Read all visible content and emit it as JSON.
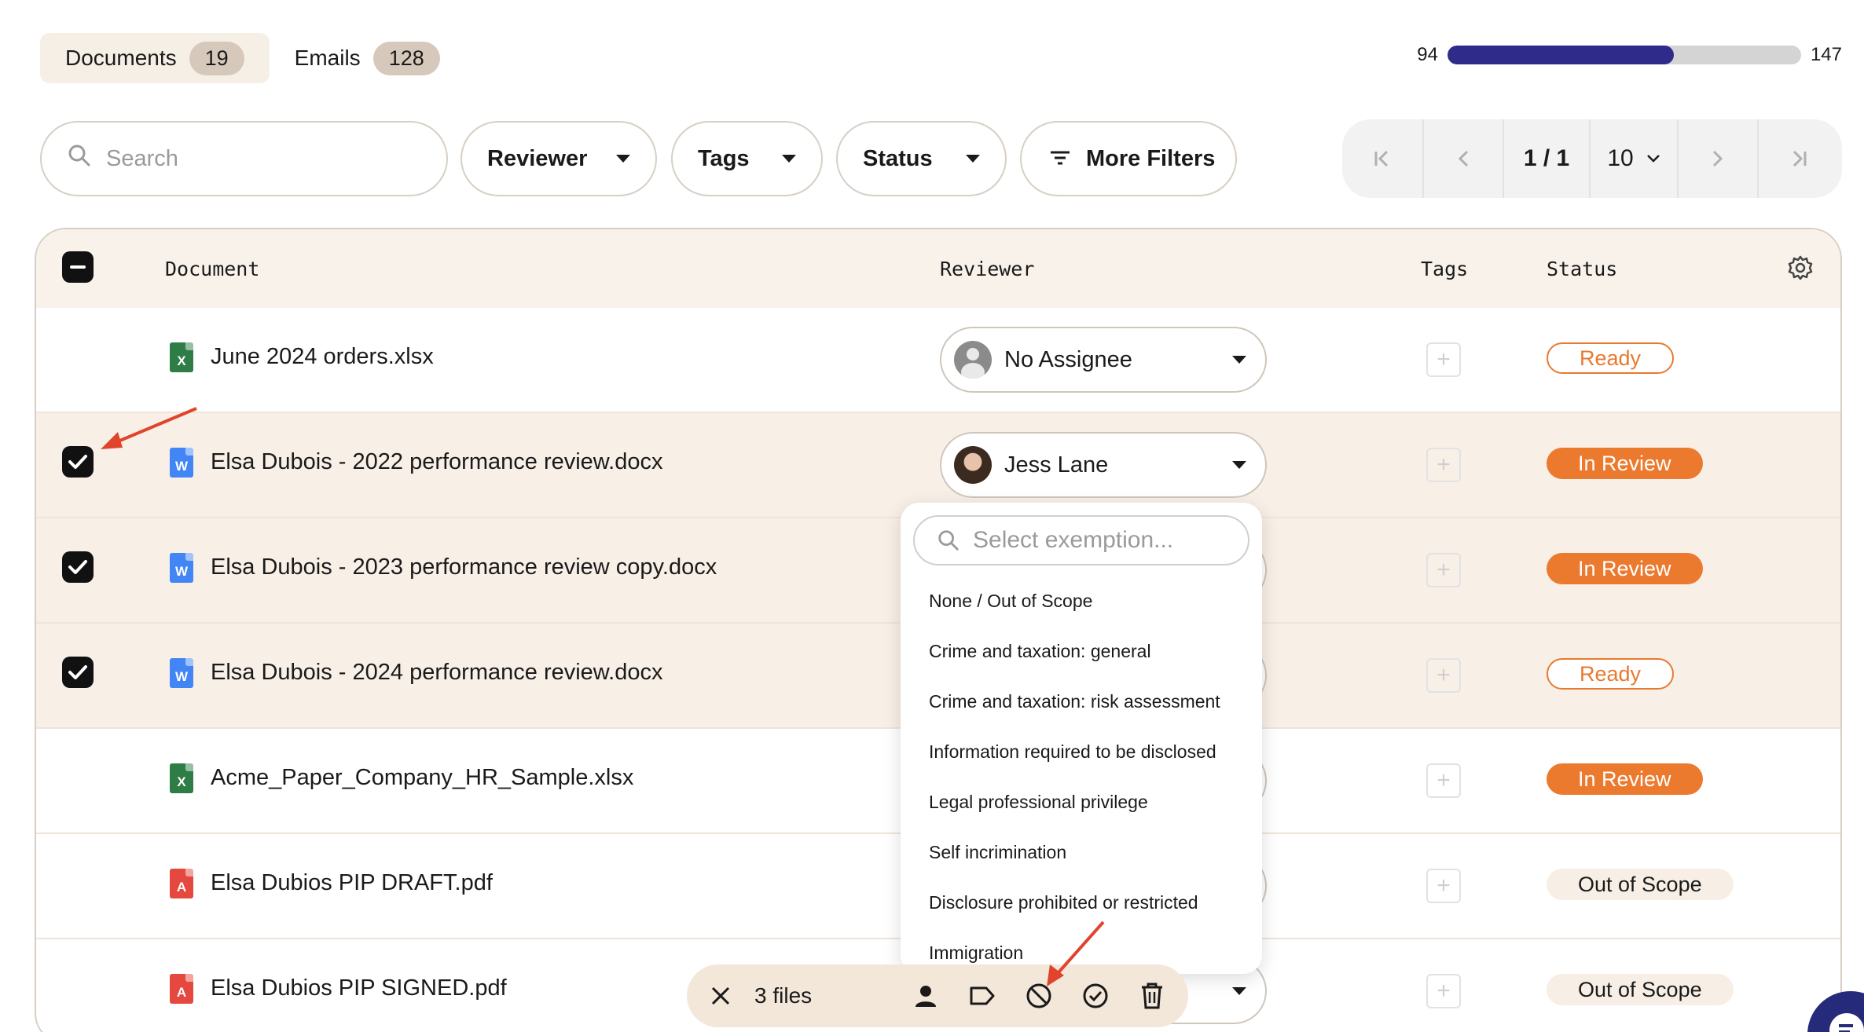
{
  "tabs": [
    {
      "label": "Documents",
      "count": "19"
    },
    {
      "label": "Emails",
      "count": "128"
    }
  ],
  "progress": {
    "current": "94",
    "total": "147",
    "fraction": 0.639
  },
  "filters": {
    "search_placeholder": "Search",
    "reviewer": "Reviewer",
    "tags": "Tags",
    "status": "Status",
    "more": "More Filters"
  },
  "pagination": {
    "page": "1 / 1",
    "per_page": "10"
  },
  "table": {
    "headers": {
      "document": "Document",
      "reviewer": "Reviewer",
      "tags": "Tags",
      "status": "Status"
    },
    "rows": [
      {
        "name": "June 2024 orders.xlsx",
        "type": "xlsx",
        "reviewer": "No Assignee",
        "status": "Ready",
        "selected": false
      },
      {
        "name": "Elsa Dubois - 2022 performance review.docx",
        "type": "docx",
        "reviewer": "Jess Lane",
        "status": "In Review",
        "selected": true
      },
      {
        "name": "Elsa Dubois - 2023 performance review copy.docx",
        "type": "docx",
        "reviewer": "",
        "status": "In Review",
        "selected": true
      },
      {
        "name": "Elsa Dubois - 2024 performance review.docx",
        "type": "docx",
        "reviewer": "",
        "status": "Ready",
        "selected": true
      },
      {
        "name": "Acme_Paper_Company_HR_Sample.xlsx",
        "type": "xlsx",
        "reviewer": "",
        "status": "In Review",
        "selected": false
      },
      {
        "name": "Elsa Dubios PIP DRAFT.pdf",
        "type": "pdf",
        "reviewer": "",
        "status": "Out of Scope",
        "selected": false
      },
      {
        "name": "Elsa Dubios PIP SIGNED.pdf",
        "type": "pdf",
        "reviewer": "",
        "status": "Out of Scope",
        "selected": false
      }
    ]
  },
  "exemption_dropdown": {
    "placeholder": "Select exemption...",
    "options": [
      "None / Out of Scope",
      "Crime and taxation: general",
      "Crime and taxation: risk assessment",
      "Information required to be disclosed",
      "Legal professional privilege",
      "Self incrimination",
      "Disclosure prohibited or restricted",
      "Immigration"
    ]
  },
  "action_bar": {
    "label": "3 files"
  },
  "icons": {
    "file_types": {
      "xlsx": "X",
      "docx": "W",
      "pdf": "A"
    }
  },
  "colors": {
    "accent": "#ec7a2e",
    "progress": "#2e2b8a",
    "tab_active_bg": "#f6efe6",
    "selected_row_bg": "#f8efe7",
    "annotation_arrow": "#e0452c"
  }
}
